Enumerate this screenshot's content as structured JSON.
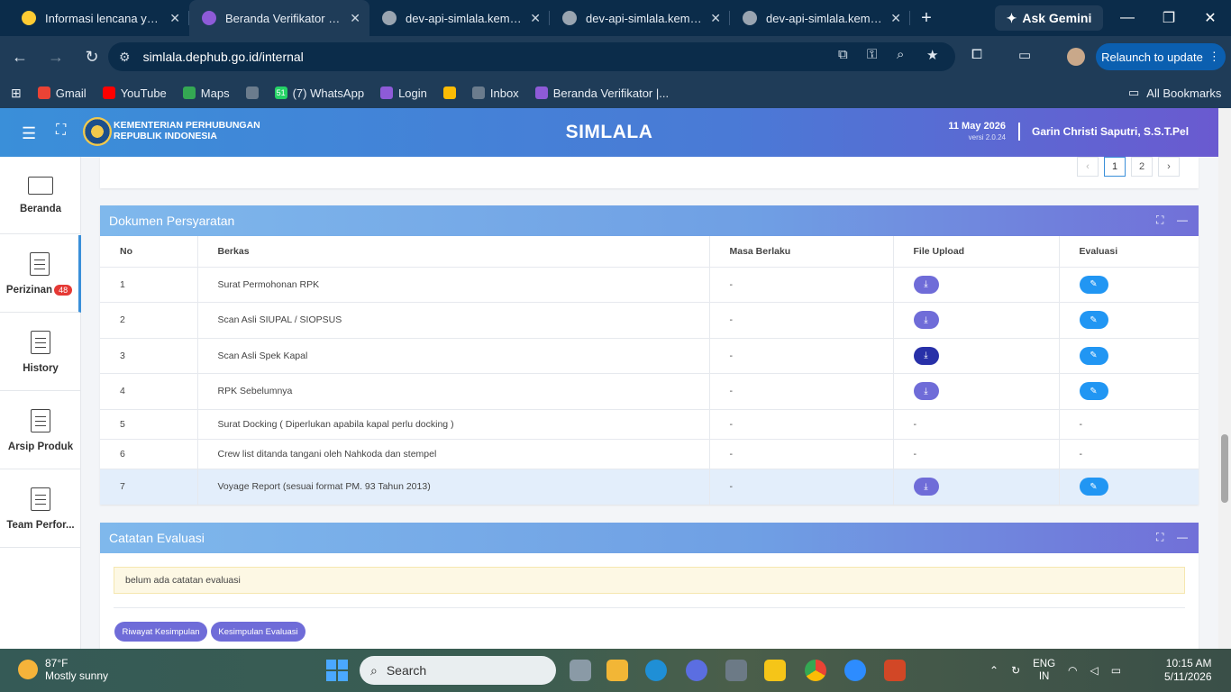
{
  "browser": {
    "tabs": [
      {
        "title": "Informasi lencana yang d",
        "active": false,
        "favicon_color": "#ffcc33"
      },
      {
        "title": "Beranda Verifikator | Sim",
        "active": true,
        "favicon_color": "#8e5bd8"
      },
      {
        "title": "dev-api-simlala.kemenhu",
        "active": false,
        "favicon_color": "#9aa5b1"
      },
      {
        "title": "dev-api-simlala.kemenhu",
        "active": false,
        "favicon_color": "#9aa5b1"
      },
      {
        "title": "dev-api-simlala.kemenhu",
        "active": false,
        "favicon_color": "#9aa5b1"
      }
    ],
    "gemini_label": "Ask Gemini",
    "url": "simlala.dephub.go.id/internal",
    "relaunch_label": "Relaunch to update",
    "bookmarks": [
      {
        "label": "Gmail",
        "color": "#ea4335"
      },
      {
        "label": "YouTube",
        "color": "#ff0000"
      },
      {
        "label": "Maps",
        "color": "#34a853"
      },
      {
        "label": "",
        "color": "#6b7c8d"
      },
      {
        "label": "(7) WhatsApp",
        "color": "#25d366",
        "icon_text": "51"
      },
      {
        "label": "Login",
        "color": "#8e5bd8"
      },
      {
        "label": "",
        "color": "#fbbc05"
      },
      {
        "label": "Inbox",
        "color": "#6b7c8d"
      },
      {
        "label": "Beranda Verifikator |...",
        "color": "#8e5bd8"
      }
    ],
    "all_bookmarks_label": "All Bookmarks"
  },
  "header": {
    "ministry_line1": "KEMENTERIAN PERHUBUNGAN",
    "ministry_line2": "REPUBLIK INDONESIA",
    "title": "SIMLALA",
    "date": "11 May 2026",
    "version": "versi 2.0.24",
    "user": "Garin Christi Saputri, S.S.T.Pel"
  },
  "sidebar": {
    "items": [
      {
        "label": "Beranda",
        "icon": "monitor-icon"
      },
      {
        "label": "Perizinan",
        "icon": "document-icon",
        "badge": "48"
      },
      {
        "label": "History",
        "icon": "document-icon"
      },
      {
        "label": "Arsip Produk",
        "icon": "document-icon"
      },
      {
        "label": "Team Perfor...",
        "icon": "document-icon"
      }
    ]
  },
  "pagination": {
    "prev": "‹",
    "pages": [
      "1",
      "2"
    ],
    "next": "›",
    "current": "1"
  },
  "dokumen": {
    "title": "Dokumen Persyaratan",
    "columns": [
      "No",
      "Berkas",
      "Masa Berlaku",
      "File Upload",
      "Evaluasi"
    ],
    "rows": [
      {
        "no": "1",
        "berkas": "Surat Permohonan RPK",
        "masa": "-",
        "upload": "button",
        "evaluasi": "button"
      },
      {
        "no": "2",
        "berkas": "Scan Asli SIUPAL / SIOPSUS",
        "masa": "-",
        "upload": "button",
        "evaluasi": "button"
      },
      {
        "no": "3",
        "berkas": "Scan Asli Spek Kapal",
        "masa": "-",
        "upload": "button-dark",
        "evaluasi": "button"
      },
      {
        "no": "4",
        "berkas": "RPK Sebelumnya",
        "masa": "-",
        "upload": "button",
        "evaluasi": "button"
      },
      {
        "no": "5",
        "berkas": "Surat Docking ( Diperlukan apabila kapal perlu docking )",
        "masa": "-",
        "upload": "-",
        "evaluasi": "-"
      },
      {
        "no": "6",
        "berkas": "Crew list ditanda tangani oleh Nahkoda dan stempel",
        "masa": "-",
        "upload": "-",
        "evaluasi": "-"
      },
      {
        "no": "7",
        "berkas": "Voyage Report (sesuai format PM. 93 Tahun 2013)",
        "masa": "-",
        "upload": "button",
        "evaluasi": "button"
      }
    ]
  },
  "catatan": {
    "title": "Catatan Evaluasi",
    "note": "belum ada catatan evaluasi",
    "btn_riwayat": "Riwayat Kesimpulan",
    "btn_kesimpulan": "Kesimpulan Evaluasi"
  },
  "taskbar": {
    "temp": "87°F",
    "weather": "Mostly sunny",
    "search_label": "Search",
    "lang1": "ENG",
    "lang2": "IN",
    "time": "10:15 AM",
    "date": "5/11/2026"
  },
  "colors": {
    "accent": "#3a8fd9",
    "purple_button": "#6f6cd8",
    "blue_button": "#2196f3"
  }
}
